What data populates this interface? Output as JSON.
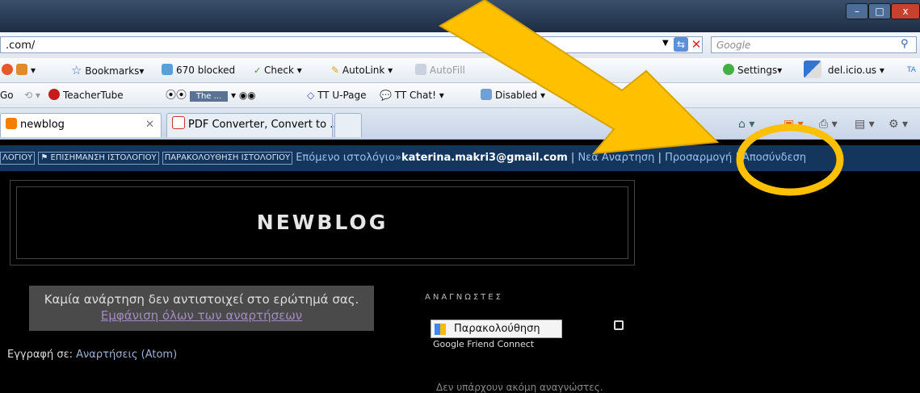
{
  "browser": {
    "address": ".com/",
    "search_placeholder": "Google",
    "window_buttons": [
      "–",
      "□",
      "x"
    ]
  },
  "toolbar1": {
    "bookmarks": "Bookmarks",
    "blocked": "670 blocked",
    "check": "Check",
    "autolink": "AutoLink",
    "autofill": "AutoFill",
    "settings": "Settings",
    "delicious": "del.icio.us",
    "ta": "TA"
  },
  "toolbar2": {
    "go": "Go",
    "teachertube": "TeacherTube",
    "the_dropdown": "The ...",
    "ttu_page": "TT U-Page",
    "tt_chat": "TT Chat!",
    "disabled": "Disabled"
  },
  "tabs": [
    {
      "label": "newblog",
      "active": true
    },
    {
      "label": "PDF Converter, Convert to ...",
      "active": false
    }
  ],
  "navbar": {
    "box1": "ΛΟΓΙΟΥ",
    "box2": "ΕΠΙΣΗΜΑΝΣΗ ΙΣΤΟΛΟΓΙΟΥ",
    "box3": "ΠΑΡΑΚΟΛΟΥΘΗΣΗ ΙΣΤΟΛΟΓΙΟΥ",
    "next_blog": "Επόμενο ιστολόγιο»",
    "email": "katerina.makri3@gmail.com",
    "sep": "|",
    "new_post": "Νεα Αναρτηση",
    "customize": "Προσαρμογή",
    "logout": "Αποσύνδεση"
  },
  "blog": {
    "title": "NEWBLOG",
    "no_posts": "Καμία ανάρτηση δεν αντιστοιχεί στο ερώτημά σας.",
    "show_all": "Εμφάνιση όλων των αναρτήσεων",
    "subscribe_label": "Εγγραφή σε:",
    "subscribe_link": "Αναρτήσεις (Atom)",
    "readers_title": "ΑΝΑΓΝΩΣΤΕΣ",
    "follow": "Παρακολούθηση",
    "gfc": "Google Friend Connect",
    "no_readers": "Δεν υπάρχουν ακόμη αναγνώστες."
  },
  "annotation": {
    "arrow_color": "#ffc000",
    "circle_color": "#ffc000"
  }
}
